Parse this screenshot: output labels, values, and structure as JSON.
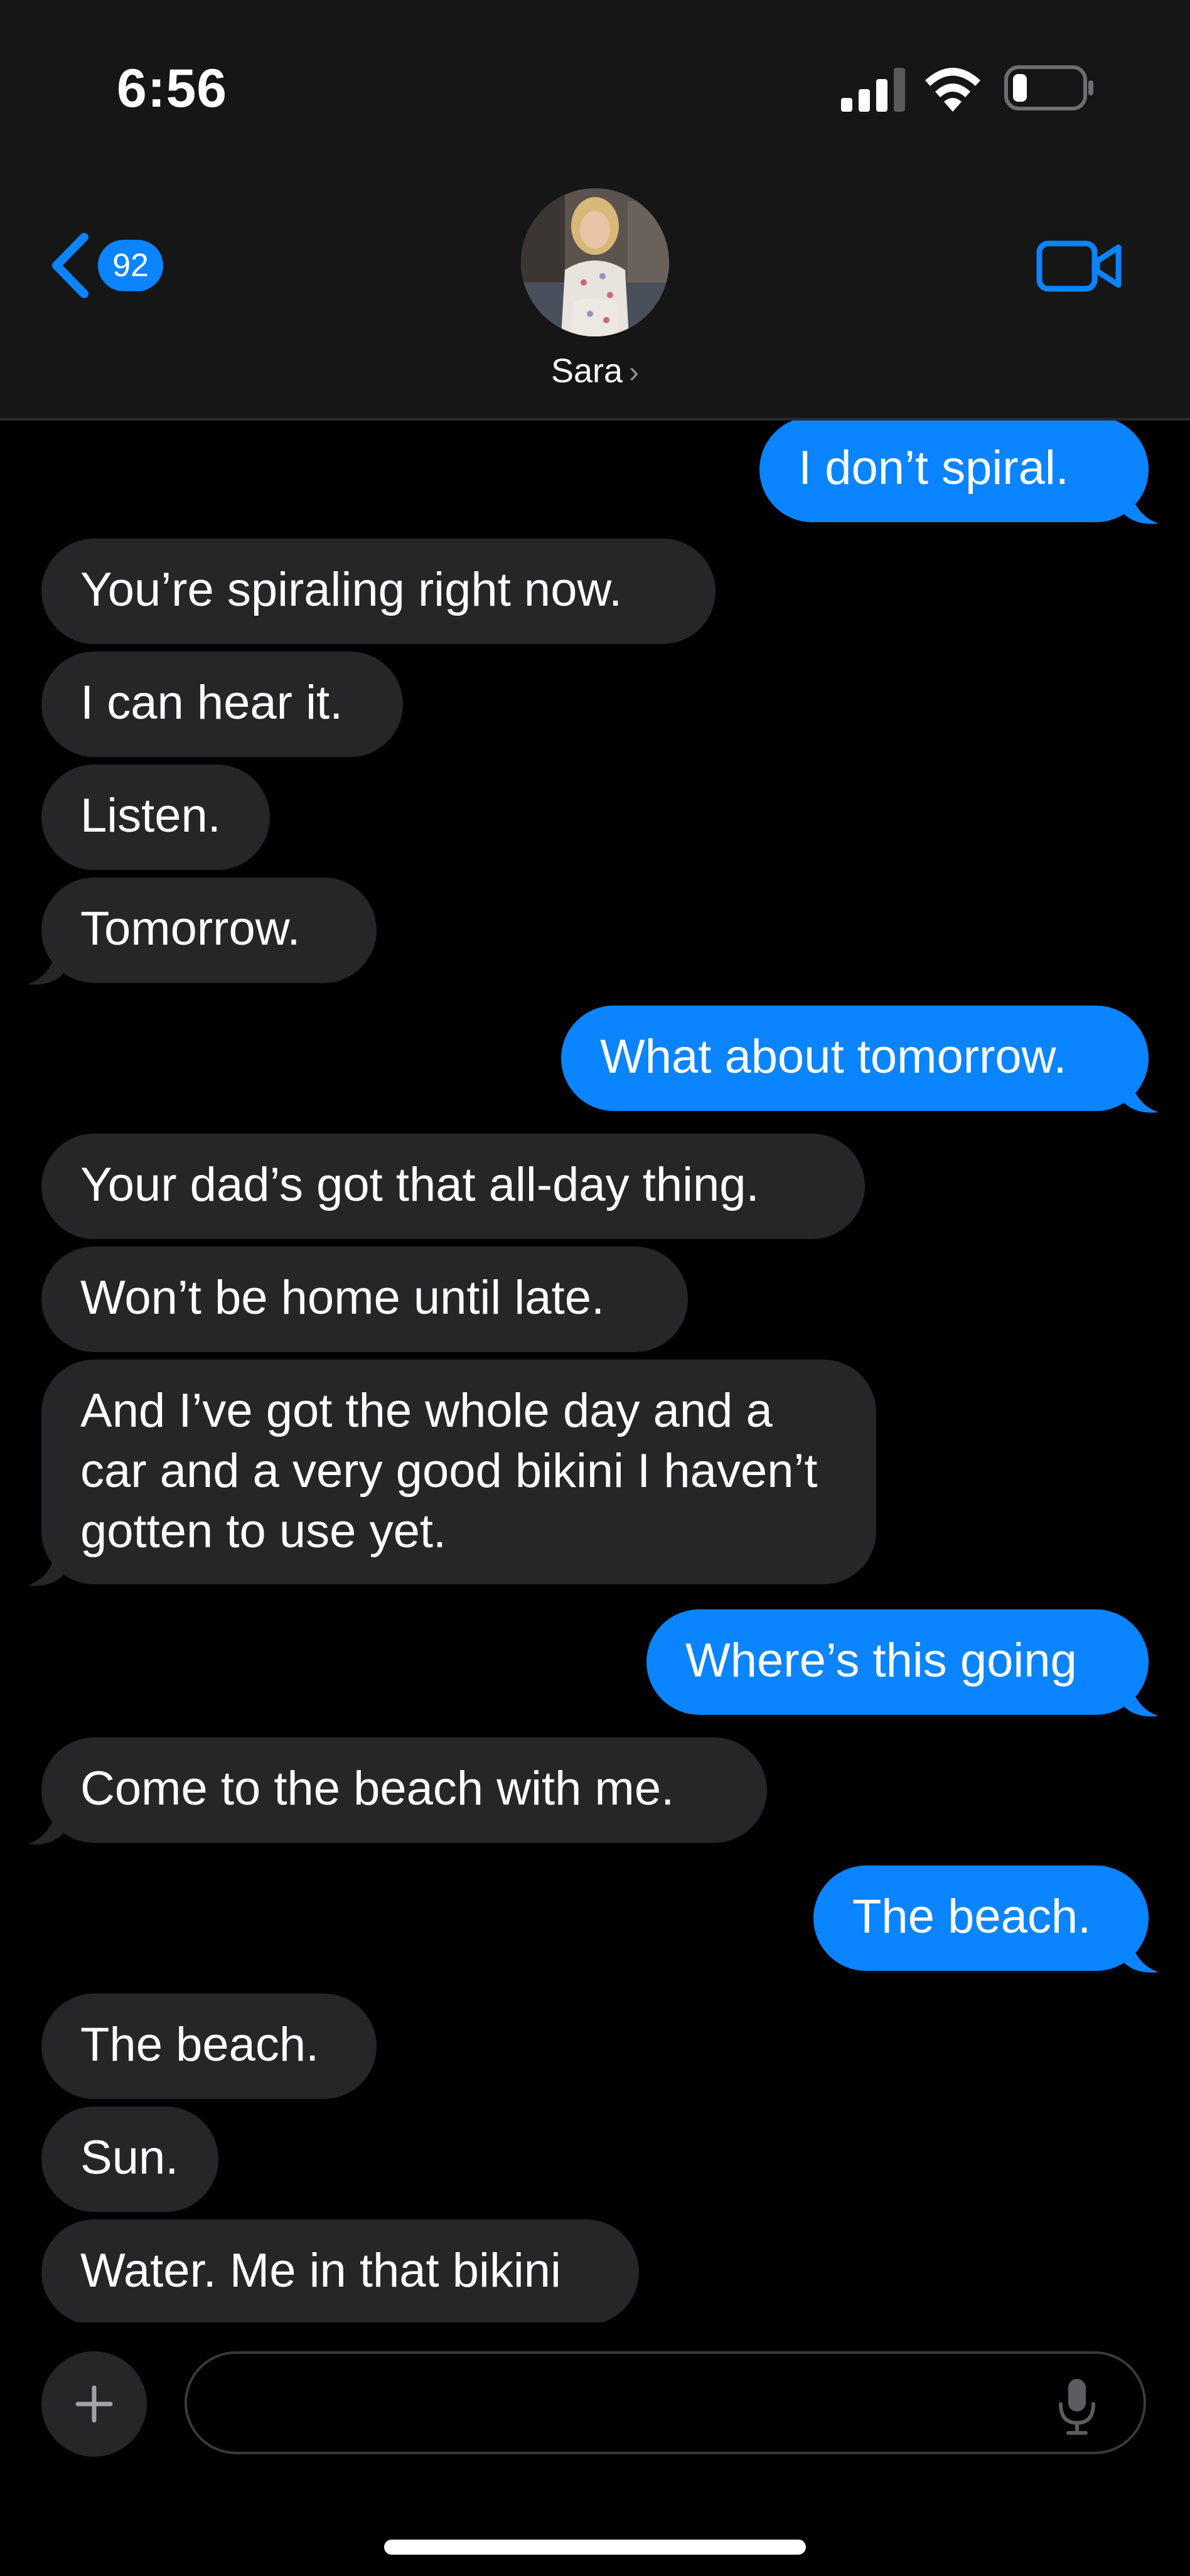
{
  "status_bar": {
    "time": "6:56"
  },
  "header": {
    "unread_count": "92",
    "contact_name": "Sara",
    "name_chevron": "›"
  },
  "messages": [
    {
      "from": "me",
      "text": "I don’t spiral."
    },
    {
      "from": "them",
      "text": "You’re spiraling right now."
    },
    {
      "from": "them",
      "text": "I can hear it."
    },
    {
      "from": "them",
      "text": "Listen."
    },
    {
      "from": "them",
      "text": "Tomorrow."
    },
    {
      "from": "me",
      "text": "What about tomorrow."
    },
    {
      "from": "them",
      "text": "Your dad’s got that all-day thing."
    },
    {
      "from": "them",
      "text": "Won’t be home until late."
    },
    {
      "from": "them",
      "text": "And I’ve got the whole day and a car and a very good bikini I haven’t gotten to use yet."
    },
    {
      "from": "me",
      "text": "Where’s this going"
    },
    {
      "from": "them",
      "text": "Come to the beach with me."
    },
    {
      "from": "me",
      "text": "The beach."
    },
    {
      "from": "them",
      "text": "The beach."
    },
    {
      "from": "them",
      "text": "Sun."
    },
    {
      "from": "them",
      "text": "Water. Me in that bikini"
    }
  ],
  "composer": {
    "placeholder": "",
    "value": ""
  },
  "icons": {
    "back": "chevron-left-icon",
    "video": "video-camera-icon",
    "add": "plus-icon",
    "mic": "microphone-icon",
    "signal": "cellular-signal-icon",
    "wifi": "wifi-icon",
    "battery": "battery-icon"
  },
  "colors": {
    "accent": "#0a84ff",
    "incoming_bubble": "#262628",
    "header_bg": "#161617",
    "background": "#000000"
  }
}
